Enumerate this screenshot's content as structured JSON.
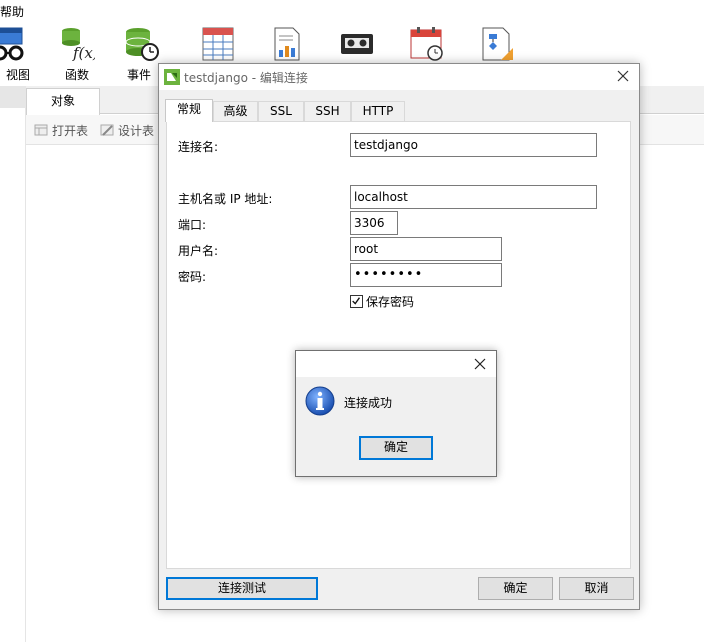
{
  "main": {
    "menu_partial": "帮助",
    "toolbar": [
      {
        "label": "视图",
        "icon": "glasses-icon"
      },
      {
        "label": "函数",
        "icon": "function-icon"
      },
      {
        "label": "事件",
        "icon": "event-icon"
      },
      {
        "label": "",
        "icon": "table-grid-icon"
      },
      {
        "label": "",
        "icon": "report-icon"
      },
      {
        "label": "",
        "icon": "backup-tape-icon"
      },
      {
        "label": "",
        "icon": "calendar-schedule-icon"
      },
      {
        "label": "",
        "icon": "model-icon"
      }
    ],
    "object_tab": "对象",
    "object_buttons": {
      "open_table": "打开表",
      "design_table": "设计表"
    }
  },
  "dialog": {
    "title": "testdjango - 编辑连接",
    "tabs": [
      "常规",
      "高级",
      "SSL",
      "SSH",
      "HTTP"
    ],
    "active_tab": "常规",
    "fields": {
      "connection_name": {
        "label": "连接名:",
        "value": "testdjango"
      },
      "host": {
        "label": "主机名或 IP 地址:",
        "value": "localhost"
      },
      "port": {
        "label": "端口:",
        "value": "3306"
      },
      "username": {
        "label": "用户名:",
        "value": "root"
      },
      "password": {
        "label": "密码:",
        "value": "••••••••"
      }
    },
    "save_password": {
      "label": "保存密码",
      "checked": true
    },
    "buttons": {
      "test": "连接测试",
      "ok": "确定",
      "cancel": "取消"
    }
  },
  "message_box": {
    "text": "连接成功",
    "ok": "确定",
    "icon": "info-icon"
  },
  "colors": {
    "accent_border": "#0078d7",
    "dialog_bg": "#f0f0f0",
    "navicat_green": "#6cb33e",
    "info_blue": "#1f5fbf"
  }
}
